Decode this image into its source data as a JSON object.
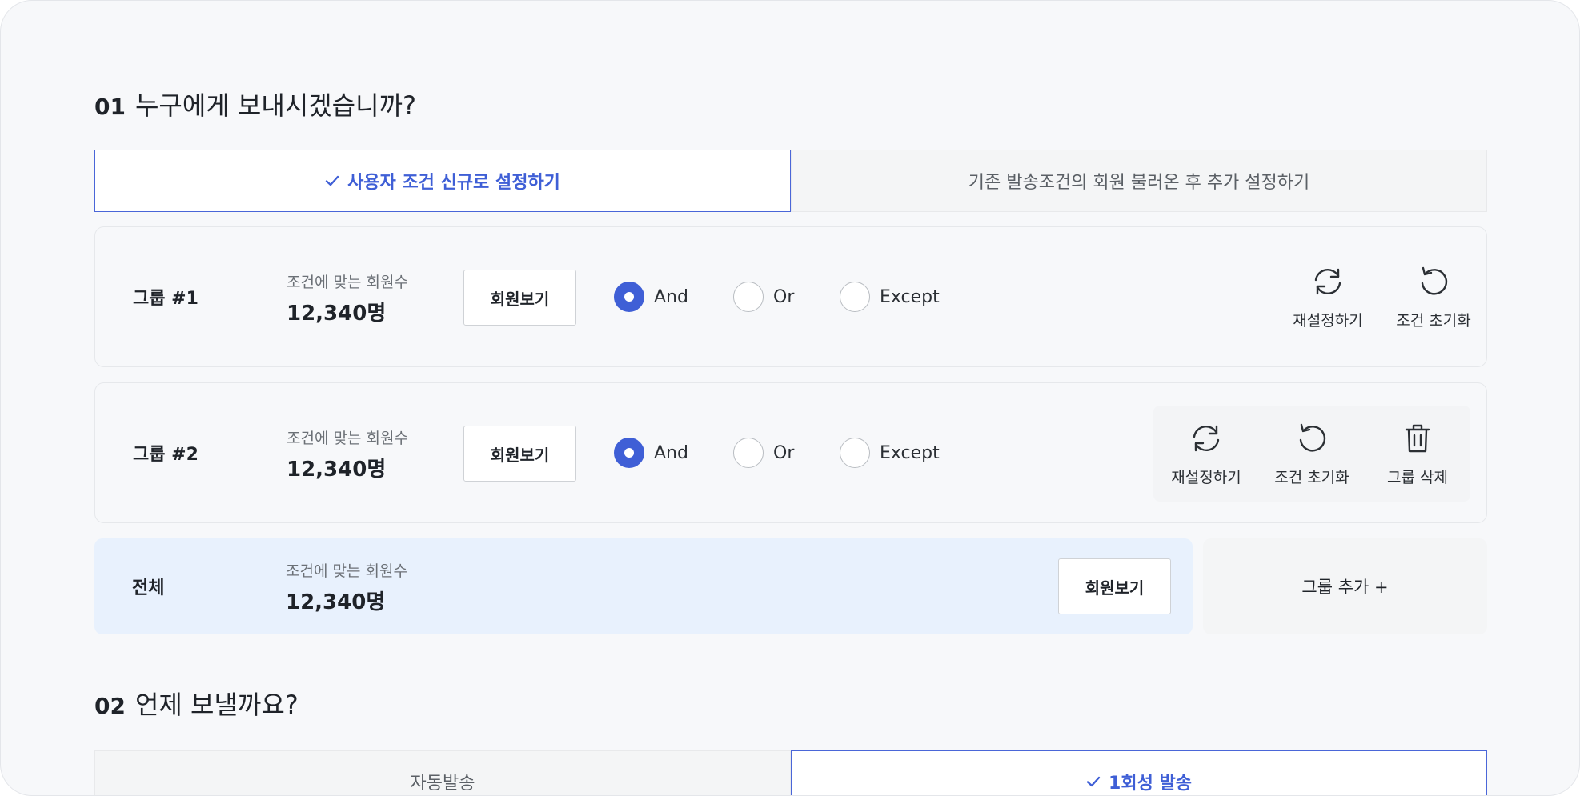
{
  "section1": {
    "num": "01",
    "title": "누구에게 보내시겠습니까?"
  },
  "segment1": {
    "options": [
      {
        "label": "사용자 조건 신규로 설정하기",
        "active": true
      },
      {
        "label": "기존 발송조건의 회원 불러온 후 추가 설정하기",
        "active": false
      }
    ]
  },
  "groups": [
    {
      "name": "그룹 #1",
      "count_label": "조건에 맞는 회원수",
      "count_value": "12,340명",
      "members_button": "회원보기",
      "radios": [
        {
          "label": "And",
          "checked": true
        },
        {
          "label": "Or",
          "checked": false
        },
        {
          "label": "Except",
          "checked": false
        }
      ],
      "actions": [
        {
          "label": "재설정하기",
          "icon": "refresh-icon"
        },
        {
          "label": "조건 초기화",
          "icon": "reset-icon"
        }
      ]
    },
    {
      "name": "그룹 #2",
      "count_label": "조건에 맞는 회원수",
      "count_value": "12,340명",
      "members_button": "회원보기",
      "radios": [
        {
          "label": "And",
          "checked": true
        },
        {
          "label": "Or",
          "checked": false
        },
        {
          "label": "Except",
          "checked": false
        }
      ],
      "actions": [
        {
          "label": "재설정하기",
          "icon": "refresh-icon"
        },
        {
          "label": "조건 초기화",
          "icon": "reset-icon"
        },
        {
          "label": "그룹 삭제",
          "icon": "trash-icon"
        }
      ]
    }
  ],
  "total": {
    "name": "전체",
    "count_label": "조건에 맞는 회원수",
    "count_value": "12,340명",
    "members_button": "회원보기"
  },
  "add_group": "그룹 추가 +",
  "section2": {
    "num": "02",
    "title": "언제 보낼까요?"
  },
  "segment2": {
    "options": [
      {
        "label": "자동발송",
        "active": false
      },
      {
        "label": "1회성 발송",
        "active": true
      }
    ]
  },
  "colors": {
    "accent": "#3f5fd6",
    "total_bg": "#e8f1fd",
    "page_bg": "#f7f8fa"
  }
}
